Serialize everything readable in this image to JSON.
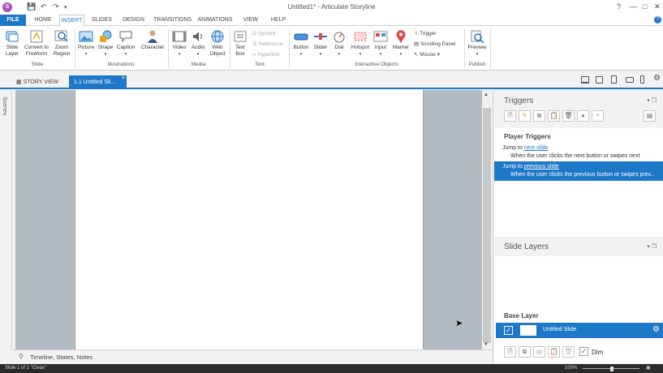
{
  "app": {
    "title": "Untitled1* - Articulate Storyline",
    "logo": "S"
  },
  "menus": [
    "FILE",
    "HOME",
    "INSERT",
    "SLIDES",
    "DESIGN",
    "TRANSITIONS",
    "ANIMATIONS",
    "VIEW",
    "HELP"
  ],
  "ribbon": {
    "slide": {
      "layer": "Slide\nLayer",
      "convert": "Convert to\nFreeform",
      "zoom": "Zoom\nRegion",
      "group": "Slide"
    },
    "illustrations": {
      "picture": "Picture",
      "shape": "Shape",
      "caption": "Caption",
      "character": "Character",
      "group": "Illustrations"
    },
    "media": {
      "video": "Video",
      "audio": "Audio",
      "web": "Web\nObject",
      "group": "Media"
    },
    "text": {
      "textbox": "Text\nBox",
      "symbol": "Symbol",
      "reference": "Reference",
      "hyperlink": "Hyperlink",
      "group": "Text"
    },
    "interactive": {
      "button": "Button",
      "slider": "Slider",
      "dial": "Dial",
      "hotspot": "Hotspot",
      "input": "Input",
      "marker": "Marker",
      "trigger": "Trigger",
      "scrolling": "Scrolling Panel",
      "mouse": "Mouse",
      "group": "Interactive Objects"
    },
    "publish": {
      "preview": "Preview",
      "group": "Publish"
    }
  },
  "tabs": {
    "story": "STORY VIEW",
    "slide": "1.1 Untitled Sli...",
    "close": "×"
  },
  "scenes": "Scenes",
  "timeline": "Timeline, States, Notes",
  "status": {
    "left": "Slide 1 of 1     \"Clean\"",
    "zoom": "100%"
  },
  "panel": {
    "triggers_title": "Triggers",
    "player_triggers": "Player Triggers",
    "trig1": {
      "pre": "Jump to",
      "link": "next slide",
      "sub": "When the user clicks the next button or swipes next"
    },
    "trig2": {
      "pre": "Jump to",
      "link": "previous slide",
      "sub": "When the user clicks the previous button or swipes prev..."
    },
    "layers_title": "Slide Layers",
    "base_layer": "Base Layer",
    "layer_name": "Untitled Slide",
    "dim": "Dim"
  }
}
